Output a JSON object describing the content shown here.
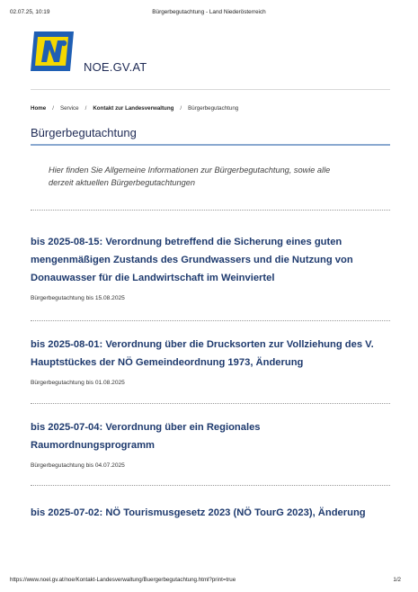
{
  "print_header": {
    "datetime": "02.07.25, 10:19",
    "title": "Bürgerbegutachtung - Land Niederösterreich"
  },
  "site": {
    "name": "NOE.GV.AT",
    "logo_icon": "noe-logo-icon",
    "brand_colors": {
      "blue": "#1f5fb4",
      "yellow": "#f5d800"
    }
  },
  "breadcrumb": [
    {
      "label": "Home",
      "bold": true
    },
    {
      "label": "Service",
      "bold": false
    },
    {
      "label": "Kontakt zur Landesverwaltung",
      "bold": true
    },
    {
      "label": "Bürgerbegutachtung",
      "bold": false
    }
  ],
  "page": {
    "title": "Bürgerbegutachtung",
    "intro": "Hier finden Sie Allgemeine Informationen zur Bürgerbegutachtung, sowie alle derzeit aktuellen Bürgerbegutachtungen"
  },
  "items": [
    {
      "title": "bis 2025-08-15: Verordnung betreffend die Sicherung eines guten mengenmäßigen Zustands des Grundwassers und die Nutzung von Donauwasser für die Landwirtschaft im Weinviertel",
      "subtitle": "Bürgerbegutachtung bis 15.08.2025"
    },
    {
      "title": "bis 2025-08-01: Verordnung über die Drucksorten zur Vollziehung des V. Hauptstückes der NÖ Gemeindeordnung 1973, Änderung",
      "subtitle": "Bürgerbegutachtung bis 01.08.2025"
    },
    {
      "title": "bis 2025-07-04: Verordnung über ein Regionales Raumordnungsprogramm",
      "subtitle": "Bürgerbegutachtung bis 04.07.2025"
    },
    {
      "title": "bis 2025-07-02: NÖ Tourismusgesetz 2023 (NÖ TourG 2023), Änderung",
      "subtitle": ""
    }
  ],
  "print_footer": {
    "url": "https://www.noel.gv.at/noe/Kontakt-Landesverwaltung/Buergerbegutachtung.html?print=true",
    "page": "1/2"
  }
}
